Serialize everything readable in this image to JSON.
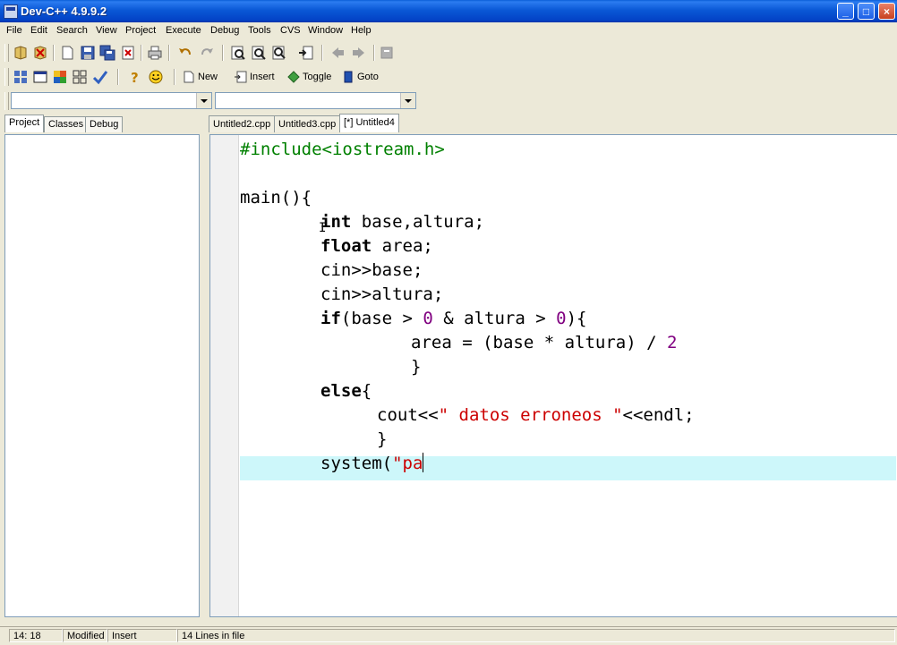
{
  "window": {
    "title": "Dev-C++ 4.9.9.2",
    "minimize": "_",
    "maximize": "□",
    "close": "×"
  },
  "menu": [
    "File",
    "Edit",
    "Search",
    "View",
    "Project",
    "Execute",
    "Debug",
    "Tools",
    "CVS",
    "Window",
    "Help"
  ],
  "toolbar2": {
    "new_label": "New",
    "insert_label": "Insert",
    "toggle_label": "Toggle",
    "goto_label": "Goto"
  },
  "left_tabs": [
    "Project",
    "Classes",
    "Debug"
  ],
  "editor_tabs": [
    "Untitled2.cpp",
    "Untitled3.cpp",
    "[*] Untitled4"
  ],
  "code": {
    "l1": "#include<iostream.h>",
    "l3": "main(){",
    "l4_kw": "int",
    "l4_rest": " base,altura;",
    "l5_kw": "float",
    "l5_rest": " area;",
    "l6": "cin>>base;",
    "l7": "cin>>altura;",
    "l8_kw": "if",
    "l8_a": "(base > ",
    "l8_n1": "0",
    "l8_b": " & altura > ",
    "l8_n2": "0",
    "l8_c": "){",
    "l9_a": "area = (base * altura) / ",
    "l9_n": "2",
    "l10": "}",
    "l11_kw": "else",
    "l11_rest": "{",
    "l12_a": "cout<<",
    "l12_s": "\" datos erroneos \"",
    "l12_b": "<<endl;",
    "l13": "}",
    "l14_a": "system(",
    "l14_s": "\"pa"
  },
  "status": {
    "position": "14: 18",
    "modified": "Modified",
    "mode": "Insert",
    "lines": "14 Lines in file"
  },
  "colors": {
    "titlebar": "#0a58d6",
    "active_line": "#cdf7fa",
    "preprocessor": "#008000",
    "number": "#800080",
    "string": "#cc0000"
  }
}
